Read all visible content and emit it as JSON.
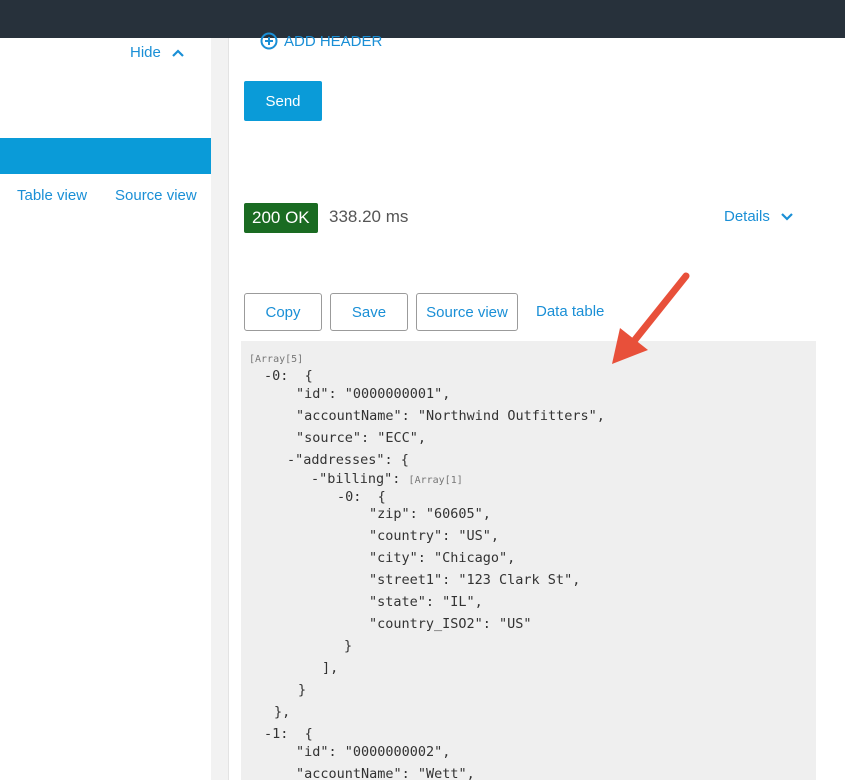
{
  "left_panel": {
    "hide_label": "Hide",
    "table_view_label": "Table view",
    "source_view_label": "Source view"
  },
  "request": {
    "add_header_label": "ADD HEADER",
    "send_label": "Send"
  },
  "response": {
    "status": "200 OK",
    "time": "338.20 ms",
    "details_label": "Details",
    "actions": {
      "copy": "Copy",
      "save": "Save",
      "source_view": "Source view",
      "data_table": "Data table"
    },
    "code": {
      "array5": "[Array[5]",
      "l1": "-0:  {",
      "l2": "\"id\": \"0000000001\",",
      "l3": "\"accountName\": \"Northwind Outfitters\",",
      "l4": "\"source\": \"ECC\",",
      "l5": "-\"addresses\": {",
      "l6": "-\"billing\": ",
      "array1": "[Array[1]",
      "l7": "-0:  {",
      "l8": "\"zip\": \"60605\",",
      "l9": "\"country\": \"US\",",
      "l10": "\"city\": \"Chicago\",",
      "l11": "\"street1\": \"123 Clark St\",",
      "l12": "\"state\": \"IL\",",
      "l13": "\"country_ISO2\": \"US\"",
      "l14": "}",
      "l15": "],",
      "l16": "}",
      "l17": "},",
      "l18": "-1:  {",
      "l19": "\"id\": \"0000000002\",",
      "l20": "\"accountName\": \"Wett\","
    }
  },
  "colors": {
    "topbar": "#27313b",
    "accent": "#0a9bd8",
    "link": "#1a8fd6",
    "status_ok": "#1a6b22",
    "annotation_arrow": "#e8503a"
  }
}
